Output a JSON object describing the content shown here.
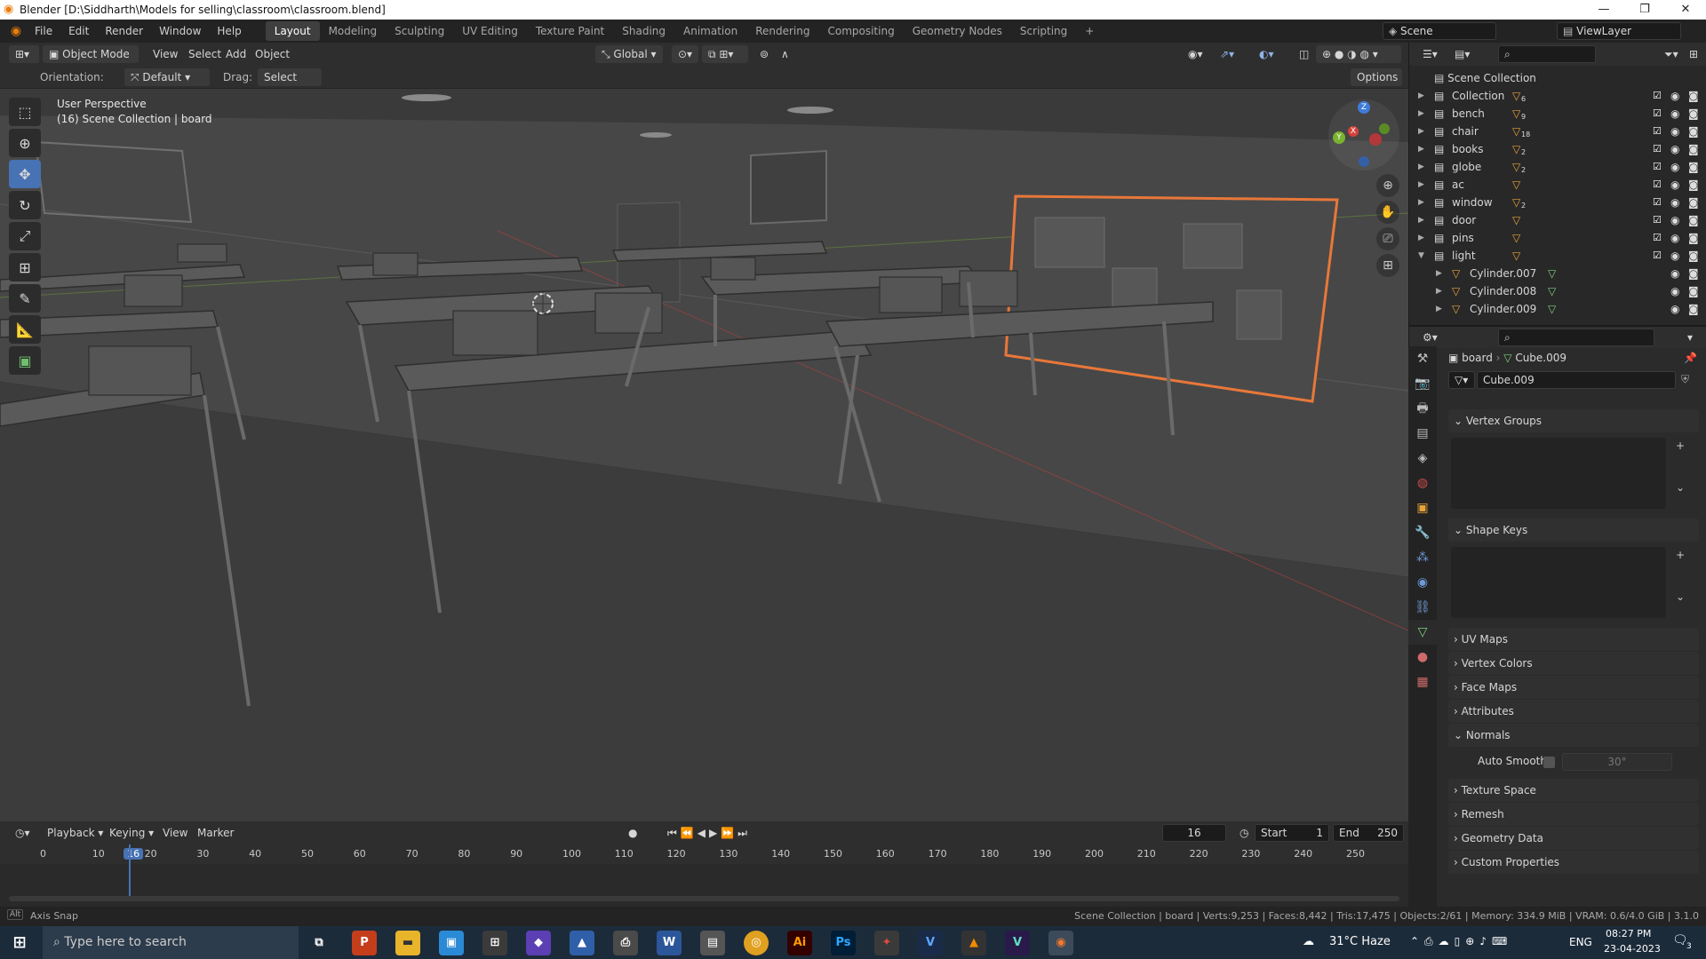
{
  "window": {
    "title": "Blender [D:\\Siddharth\\Models for selling\\classroom\\classroom.blend]",
    "controls": [
      "—",
      "❐",
      "✕"
    ]
  },
  "menu": {
    "items": [
      "File",
      "Edit",
      "Render",
      "Window",
      "Help"
    ],
    "workspaces": [
      "Layout",
      "Modeling",
      "Sculpting",
      "UV Editing",
      "Texture Paint",
      "Shading",
      "Animation",
      "Rendering",
      "Compositing",
      "Geometry Nodes",
      "Scripting",
      "+"
    ],
    "active_workspace": "Layout",
    "scene": "Scene",
    "view_layer": "ViewLayer"
  },
  "viewport_header": {
    "mode": "Object Mode",
    "menus": [
      "View",
      "Select",
      "Add",
      "Object"
    ],
    "transform": "Global",
    "orientation_label": "Orientation:",
    "orientation_value": "Default",
    "drag_label": "Drag:",
    "drag_value": "Select Box",
    "options": "Options"
  },
  "viewport": {
    "perspective": "User Perspective",
    "context": "(16) Scene Collection | board",
    "gizmo_axes": [
      "Z",
      "X",
      "Y"
    ]
  },
  "timeline": {
    "menus": [
      "Playback",
      "Keying",
      "View",
      "Marker"
    ],
    "current_frame": "16",
    "start_label": "Start",
    "start": "1",
    "end_label": "End",
    "end": "250",
    "ticks": [
      "0",
      "10",
      "16",
      "20",
      "30",
      "40",
      "50",
      "60",
      "70",
      "80",
      "90",
      "100",
      "110",
      "120",
      "130",
      "140",
      "150",
      "160",
      "170",
      "180",
      "190",
      "200",
      "210",
      "220",
      "230",
      "240",
      "250"
    ]
  },
  "status": {
    "left": "Axis Snap",
    "right": "Scene Collection | board | Verts:9,253 | Faces:8,442 | Tris:17,475 | Objects:2/61 | Memory: 334.9 MiB | VRAM: 0.6/4.0 GiB | 3.1.0"
  },
  "outliner": {
    "root": "Scene Collection",
    "rows": [
      {
        "name": "Collection",
        "badge": "6",
        "indent": 0
      },
      {
        "name": "bench",
        "badge": "9",
        "indent": 0
      },
      {
        "name": "chair",
        "badge": "18",
        "indent": 0
      },
      {
        "name": "books",
        "badge": "2",
        "indent": 0
      },
      {
        "name": "globe",
        "badge": "2",
        "indent": 0
      },
      {
        "name": "ac",
        "badge": "",
        "indent": 0
      },
      {
        "name": "window",
        "badge": "2",
        "indent": 0
      },
      {
        "name": "door",
        "badge": "",
        "indent": 0
      },
      {
        "name": "pins",
        "badge": "",
        "indent": 0
      },
      {
        "name": "light",
        "badge": "",
        "indent": 0
      },
      {
        "name": "Cylinder.007",
        "badge": "",
        "indent": 1
      },
      {
        "name": "Cylinder.008",
        "badge": "",
        "indent": 1
      },
      {
        "name": "Cylinder.009",
        "badge": "",
        "indent": 1
      }
    ]
  },
  "properties": {
    "breadcrumb_object": "board",
    "breadcrumb_data": "Cube.009",
    "mesh_name": "Cube.009",
    "panels": [
      "Vertex Groups",
      "Shape Keys",
      "UV Maps",
      "Vertex Colors",
      "Face Maps",
      "Attributes",
      "Normals",
      "Texture Space",
      "Remesh",
      "Geometry Data",
      "Custom Properties"
    ],
    "auto_smooth_label": "Auto Smooth",
    "auto_smooth_angle": "30°"
  },
  "taskbar": {
    "search_placeholder": "Type here to search",
    "weather": "31°C  Haze",
    "lang": "ENG",
    "time": "08:27 PM",
    "date": "23-04-2023",
    "notif": "3"
  },
  "colors": {
    "accent": "#4772b3",
    "selection_outline": "#e8773a",
    "blender_orange": "#e87d0d"
  }
}
